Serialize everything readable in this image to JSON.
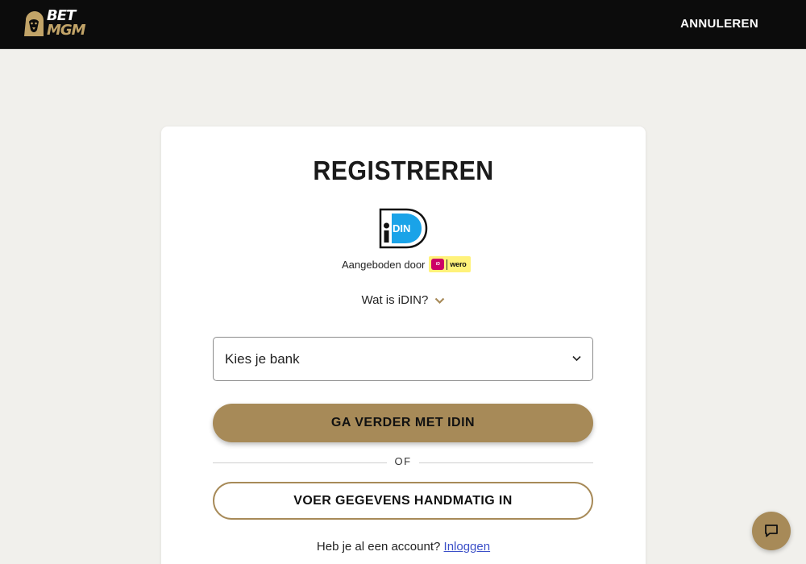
{
  "header": {
    "logo_line1": "BET",
    "logo_line2": "MGM",
    "cancel_label": "ANNULEREN"
  },
  "register": {
    "title": "REGISTREREN",
    "idin_logo_text": "DIN",
    "offered_by_label": "Aangeboden door",
    "partner_badge": "wero",
    "what_is_idin": "Wat is iDIN?",
    "bank_select": {
      "selected": "Kies je bank"
    },
    "continue_button": "GA VERDER MET IDIN",
    "or_label": "OF",
    "manual_button": "VOER GEGEVENS HANDMATIG IN",
    "have_account_text": "Heb je al een account?",
    "login_link": "Inloggen"
  },
  "icons": {
    "logo": "lion-icon",
    "chevron": "chevron-down-icon",
    "chat": "chat-icon"
  },
  "colors": {
    "header_bg": "#0c0c0c",
    "page_bg": "#f1f0ec",
    "accent_gold": "#a78a58",
    "link_blue": "#3b4fc8",
    "idin_blue": "#1aa3e8",
    "partner_badge_bg": "#fff27a",
    "ideal_pink": "#cc0066"
  }
}
